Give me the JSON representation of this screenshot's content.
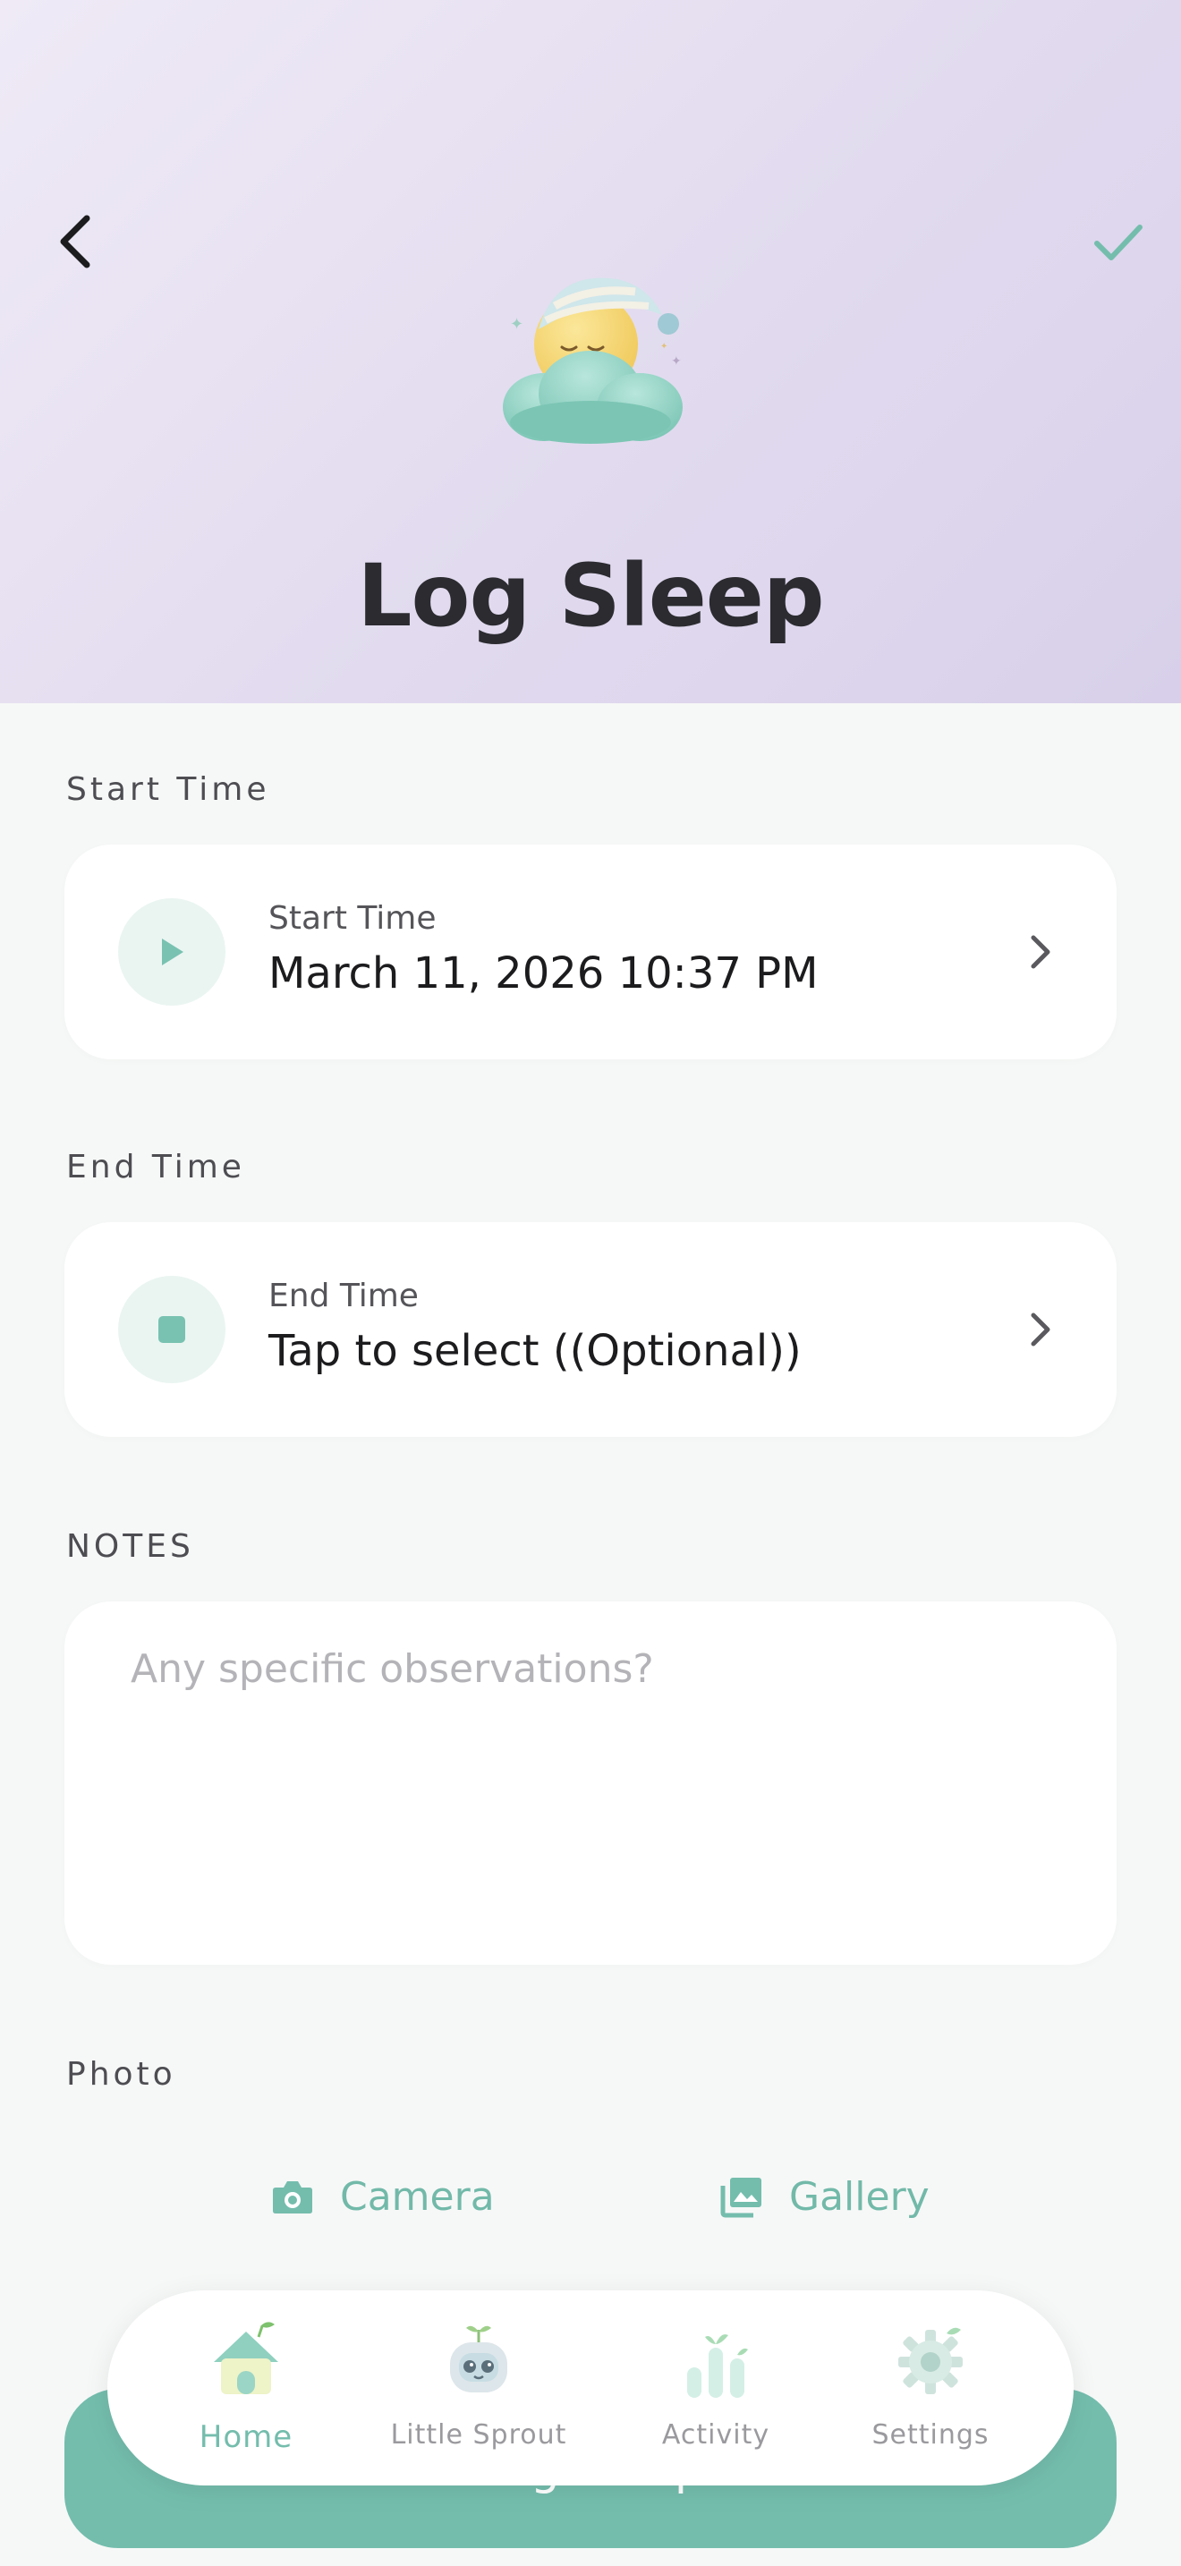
{
  "header": {
    "title": "Log Sleep",
    "back_icon": "chevron-left-icon",
    "save_icon": "checkmark-icon",
    "mascot": "sleeping-moon-cloud-mascot"
  },
  "start_section": {
    "label": "Start Time",
    "sub_label": "Start Time",
    "value": "March 11, 2026 10:37 PM",
    "icon": "play-icon"
  },
  "end_section": {
    "label": "End Time",
    "sub_label": "End Time",
    "value": "Tap to select ((Optional))",
    "icon": "stop-icon"
  },
  "notes": {
    "label": "NOTES",
    "value": "",
    "placeholder": "Any specific observations?"
  },
  "photo": {
    "label": "Photo",
    "camera_label": "Camera",
    "gallery_label": "Gallery"
  },
  "primary_button": {
    "label": "Log Sleep"
  },
  "bottom_nav": {
    "items": [
      {
        "label": "Home",
        "icon": "home-icon",
        "active": true
      },
      {
        "label": "Little Sprout",
        "icon": "robot-sprout-icon",
        "active": false
      },
      {
        "label": "Activity",
        "icon": "bar-chart-sprout-icon",
        "active": false
      },
      {
        "label": "Settings",
        "icon": "gear-icon",
        "active": false
      }
    ]
  },
  "colors": {
    "accent": "#74bdad",
    "header_bg": "#e4ddf0",
    "background": "#f6f8f7"
  }
}
